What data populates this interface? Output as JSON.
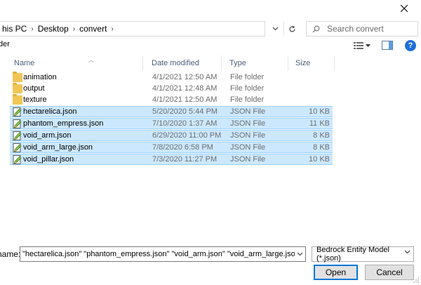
{
  "close": {
    "glyph": "✕"
  },
  "breadcrumb": {
    "items": [
      "his PC",
      "Desktop",
      "convert"
    ],
    "separator": "›",
    "trailing_chevron": "›"
  },
  "search": {
    "placeholder": "Search convert"
  },
  "toolbar": {
    "left_label": "der"
  },
  "help": {
    "label": "?"
  },
  "columns": {
    "name": "Name",
    "date": "Date modified",
    "type": "Type",
    "size": "Size"
  },
  "files": [
    {
      "name": "animation",
      "date": "4/1/2021 12:50 AM",
      "type": "File folder",
      "size": "",
      "kind": "folder",
      "selected": false
    },
    {
      "name": "output",
      "date": "4/1/2021 12:48 AM",
      "type": "File folder",
      "size": "",
      "kind": "folder",
      "selected": false
    },
    {
      "name": "texture",
      "date": "4/1/2021 12:50 AM",
      "type": "File folder",
      "size": "",
      "kind": "folder",
      "selected": false
    },
    {
      "name": "hectarelica.json",
      "date": "5/20/2020 5:44 PM",
      "type": "JSON File",
      "size": "10 KB",
      "kind": "json",
      "selected": true
    },
    {
      "name": "phantom_empress.json",
      "date": "7/10/2020 1:37 AM",
      "type": "JSON File",
      "size": "11 KB",
      "kind": "json",
      "selected": true
    },
    {
      "name": "void_arm.json",
      "date": "6/29/2020 11:00 PM",
      "type": "JSON File",
      "size": "8 KB",
      "kind": "json",
      "selected": true
    },
    {
      "name": "void_arm_large.json",
      "date": "7/8/2020 6:58 PM",
      "type": "JSON File",
      "size": "8 KB",
      "kind": "json",
      "selected": true
    },
    {
      "name": "void_pillar.json",
      "date": "7/3/2020 11:27 PM",
      "type": "JSON File",
      "size": "10 KB",
      "kind": "json",
      "selected": true
    }
  ],
  "footer": {
    "filename_label": "name:",
    "filename_value": "\"hectarelica.json\" \"phantom_empress.json\" \"void_arm.json\" \"void_arm_large.json\" \"void_pillar.jso",
    "filetype_value": "Bedrock Entity Model (*.json)",
    "open_label": "Open",
    "cancel_label": "Cancel"
  },
  "colors": {
    "selection": "#cce8ff",
    "selection_border": "#99d1ff",
    "accent": "#0078d7",
    "help_blue": "#1e6fd9",
    "folder": "#f0c756"
  }
}
